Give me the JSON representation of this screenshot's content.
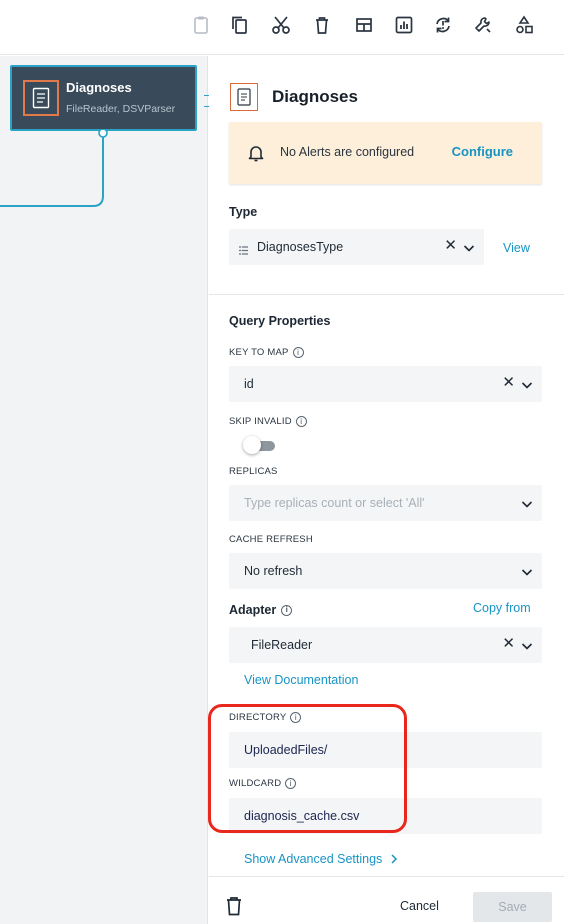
{
  "toolbar": {
    "icons": [
      "clipboard-icon",
      "copy-icon",
      "scissors-icon",
      "trash-icon",
      "table-icon",
      "chart-icon",
      "refresh-icon",
      "wrench-icon",
      "shapes-icon"
    ]
  },
  "canvas": {
    "node": {
      "title": "Diagnoses",
      "subtitle": "FileReader, DSVParser"
    }
  },
  "panel": {
    "title": "Diagnoses",
    "alert": {
      "text": "No Alerts are configured",
      "action": "Configure"
    },
    "type": {
      "label": "Type",
      "value": "DiagnosesType",
      "view_link": "View"
    },
    "query_properties": {
      "heading": "Query Properties",
      "key_to_map": {
        "label": "KEY TO MAP",
        "value": "id"
      },
      "skip_invalid": {
        "label": "SKIP INVALID",
        "enabled": false
      },
      "replicas": {
        "label": "REPLICAS",
        "placeholder": "Type replicas count or select 'All'"
      },
      "cache_refresh": {
        "label": "CACHE REFRESH",
        "value": "No refresh"
      }
    },
    "adapter": {
      "label": "Adapter",
      "copy_from": "Copy from",
      "value": "FileReader",
      "docs_link": "View Documentation"
    },
    "directory": {
      "label": "DIRECTORY",
      "value": "UploadedFiles/"
    },
    "wildcard": {
      "label": "WILDCARD",
      "value": "diagnosis_cache.csv"
    },
    "advanced_link": "Show Advanced Settings",
    "footer": {
      "cancel": "Cancel",
      "save": "Save"
    }
  },
  "colors": {
    "accent": "#1794c4",
    "node_bg": "#394a5a",
    "node_border": "#2aa3c6",
    "alert_bg": "#fdefd9",
    "highlight": "#e8281c",
    "icon_orange": "#e07a4a"
  }
}
